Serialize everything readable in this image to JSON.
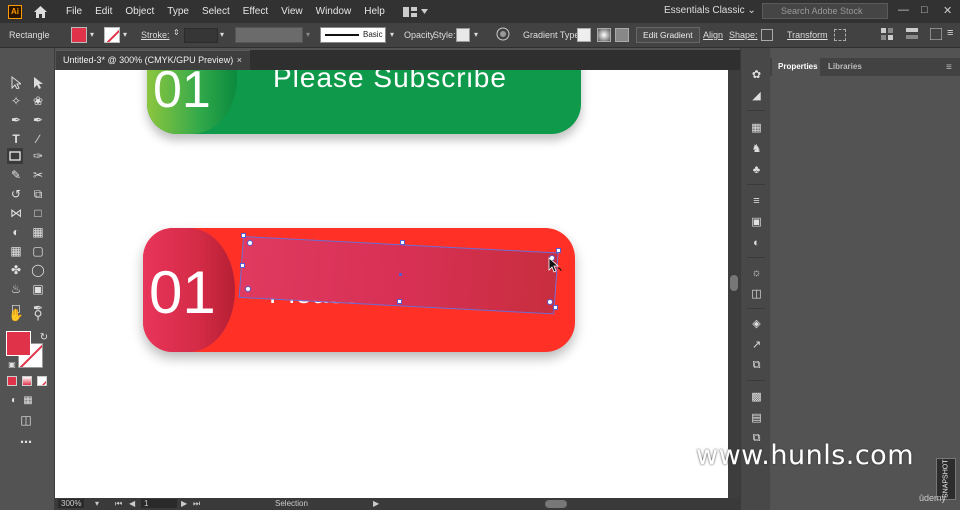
{
  "menubar": {
    "app_icon": "Ai",
    "home_icon": "home-icon",
    "items": [
      "File",
      "Edit",
      "Object",
      "Type",
      "Select",
      "Effect",
      "View",
      "Window",
      "Help"
    ],
    "workspace": "Essentials Classic",
    "search_placeholder": "Search Adobe Stock"
  },
  "controlbar": {
    "object_type": "Rectangle",
    "stroke_label": "Stroke:",
    "brush_label": "Basic",
    "opacity_label": "Opacity",
    "style_label": "Style:",
    "gradient_type_label": "Gradient Type:",
    "edit_gradient": "Edit Gradient",
    "align": "Align",
    "shape": "Shape:",
    "transform": "Transform",
    "fill_color": "#e0334a"
  },
  "document": {
    "tab_title": "Untitled-3* @ 300% (CMYK/GPU Preview)",
    "close_glyph": "×"
  },
  "artboard": {
    "green_button": {
      "number": "01",
      "label": "Please Subscribe"
    },
    "red_button": {
      "number": "01",
      "label": "Please S"
    }
  },
  "statusbar": {
    "zoom": "300%",
    "page": "1",
    "tool": "Selection"
  },
  "panel": {
    "tabs": [
      "Properties",
      "Libraries"
    ]
  },
  "watermark": {
    "site": "www.hunls.com",
    "brand": "ûdemy",
    "vertical": "SNAPSHOT"
  }
}
